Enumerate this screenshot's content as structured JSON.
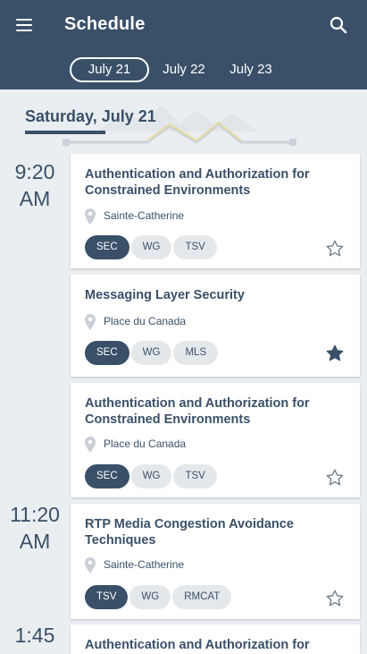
{
  "appbar": {
    "title": "Schedule"
  },
  "tabs": [
    "July 21",
    "July 22",
    "July 23"
  ],
  "active_tab": "July 21",
  "date_header": "Saturday, July 21",
  "times": [
    {
      "line1": "9:20",
      "line2": "AM"
    },
    {
      "line1": "11:20",
      "line2": "AM"
    },
    {
      "line1": "1:45",
      "line2": ""
    }
  ],
  "sessions": [
    {
      "title_line1": "Authentication and Authorization for",
      "title_line2": "Constrained Environments",
      "room": "Sainte-Catherine",
      "tags": [
        "SEC",
        "WG",
        "TSV"
      ],
      "starred": false
    },
    {
      "title_line1": "Messaging Layer Security",
      "title_line2": "",
      "room": "Place du Canada",
      "tags": [
        "SEC",
        "WG",
        "MLS"
      ],
      "starred": true
    },
    {
      "title_line1": "Authentication and Authorization for",
      "title_line2": "Constrained Environments",
      "room": "Place du Canada",
      "tags": [
        "SEC",
        "WG",
        "TSV"
      ],
      "starred": false
    },
    {
      "title_line1": "RTP Media Congestion Avoidance",
      "title_line2": "Techniques",
      "room": "Sainte-Catherine",
      "tags": [
        "TSV",
        "WG",
        "RMCAT"
      ],
      "starred": false
    },
    {
      "title_line1": "Authentication and Authorization for",
      "title_line2": "",
      "room": "",
      "tags": [],
      "starred": false
    }
  ],
  "colors": {
    "primary": "#3a5069",
    "background": "#eaeef1",
    "tag_bg": "#e5e8eb"
  },
  "icons": {
    "menu": "menu-icon",
    "search": "search-icon",
    "location": "location-pin-icon",
    "star": "star-icon"
  }
}
